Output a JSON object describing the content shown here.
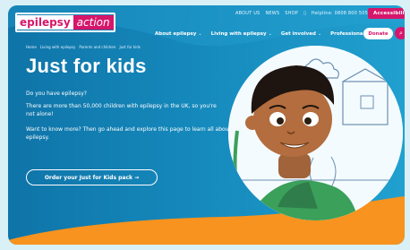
{
  "logo": {
    "part1": "epilepsy",
    "part2": "action"
  },
  "utility_nav": {
    "items": [
      "ABOUT US",
      "NEWS",
      "SHOP"
    ],
    "helpline": "Helpline: 0808 800 5050",
    "accessibility": "Accessibility"
  },
  "main_nav": {
    "items": [
      "About epilepsy",
      "Living with epilepsy",
      "Get involved",
      "Professionals"
    ],
    "donate": "Donate"
  },
  "breadcrumb": [
    "Home",
    "Living with epilepsy",
    "Parents and children",
    "Just for kids"
  ],
  "page": {
    "title": "Just for kids",
    "p1": "Do you have epilepsy?",
    "p2": "There are more than 50,000 children with epilepsy in the UK, so you're not alone!",
    "p3": "Want to know more? Then go ahead and explore this page to learn all about epilepsy.",
    "cta": "Order your Just for Kids pack"
  },
  "colors": {
    "brand_pink": "#d6166b",
    "blue": "#1588bb",
    "orange": "#f7931e"
  }
}
